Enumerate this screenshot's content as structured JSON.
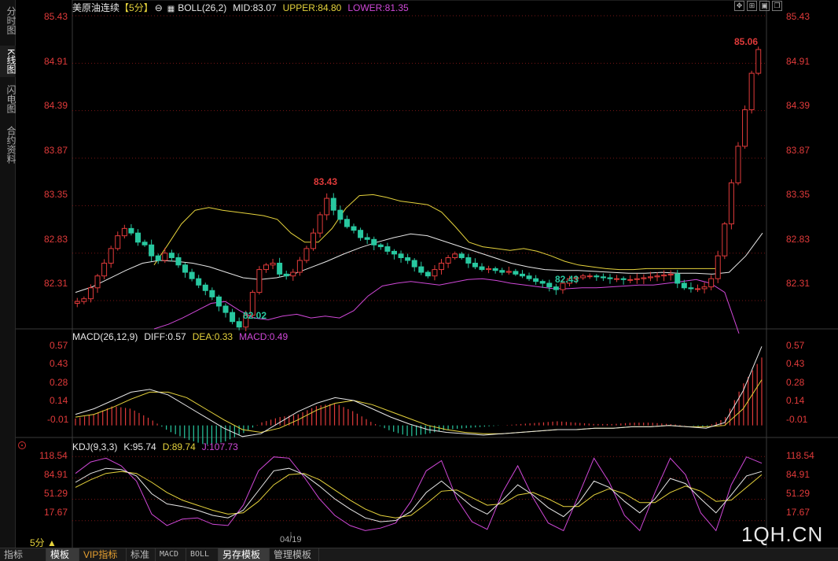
{
  "side_tabs": [
    {
      "label": "分时图",
      "active": false
    },
    {
      "label": "K线图",
      "active": true
    },
    {
      "label": "闪电图",
      "active": false
    },
    {
      "label": "合约资料",
      "active": false
    }
  ],
  "main_header": {
    "instrument": "美原油连续",
    "period_tag": "【5分】",
    "boll_label": "BOLL(26,2)",
    "mid": "MID:83.07",
    "upper": "UPPER:84.80",
    "lower": "LOWER:81.35"
  },
  "macd_header": {
    "label": "MACD(26,12,9)",
    "diff": "DIFF:0.57",
    "dea": "DEA:0.33",
    "macd": "MACD:0.49"
  },
  "kdj_header": {
    "label": "KDJ(9,3,3)",
    "k": "K:95.74",
    "d": "D:89.74",
    "j": "J:107.73"
  },
  "toolbar_icons": [
    "fullscreen-icon",
    "expand-icon",
    "chart-settings-icon",
    "restore-icon",
    "close-icon"
  ],
  "price_axis_ticks": [
    "85.43",
    "84.91",
    "84.39",
    "83.87",
    "83.35",
    "82.83",
    "82.31"
  ],
  "macd_axis_ticks": [
    "0.57",
    "0.43",
    "0.28",
    "0.14",
    "-0.01"
  ],
  "kdj_axis_ticks": [
    "118.54",
    "84.91",
    "51.29",
    "17.67"
  ],
  "annotations": {
    "high": "85.06",
    "local_high": "83.43",
    "low": "82.02",
    "local_low": "82.43"
  },
  "x_axis_label": "04/19",
  "period_selector": "5分 ▲",
  "watermark": "1QH.CN",
  "bottom_tabs": [
    {
      "label": "指标",
      "active": false,
      "vip": false,
      "mono": false
    },
    {
      "label": "模板",
      "active": true,
      "vip": false,
      "mono": false
    },
    {
      "label": "VIP指标",
      "active": false,
      "vip": true,
      "mono": false
    },
    {
      "label": "标准",
      "active": false,
      "vip": false,
      "mono": false
    },
    {
      "label": "MACD",
      "active": false,
      "vip": false,
      "mono": true
    },
    {
      "label": "BOLL",
      "active": false,
      "vip": false,
      "mono": true
    },
    {
      "label": "另存模板",
      "active": true,
      "vip": false,
      "mono": false
    },
    {
      "label": "管理模板",
      "active": false,
      "vip": false,
      "mono": false
    }
  ],
  "colors": {
    "up": "#e03a3a",
    "down": "#28c8a0",
    "mid_line": "#e8e8e8",
    "upper_line": "#e6d33c",
    "lower_line": "#d048d8",
    "grid": "#7a1616",
    "border": "#3a3a3a"
  },
  "chart_data": {
    "type": "candlestick",
    "price_axis": {
      "min": 82.0,
      "max": 85.43
    },
    "price_path": [
      82.3,
      82.33,
      82.45,
      82.58,
      82.72,
      82.88,
      83.02,
      83.1,
      83.05,
      82.95,
      82.92,
      82.8,
      82.75,
      82.83,
      82.78,
      82.7,
      82.62,
      82.55,
      82.48,
      82.42,
      82.35,
      82.25,
      82.18,
      82.08,
      82.02,
      82.15,
      82.4,
      82.65,
      82.7,
      82.72,
      82.6,
      82.58,
      82.62,
      82.75,
      82.88,
      83.05,
      83.25,
      83.43,
      83.3,
      83.2,
      83.12,
      83.08,
      83.0,
      82.98,
      82.92,
      82.9,
      82.85,
      82.82,
      82.78,
      82.75,
      82.68,
      82.62,
      82.58,
      82.65,
      82.72,
      82.78,
      82.82,
      82.78,
      82.72,
      82.68,
      82.65,
      82.66,
      82.64,
      82.62,
      82.63,
      82.6,
      82.58,
      82.55,
      82.52,
      82.5,
      82.46,
      82.43,
      82.5,
      82.55,
      82.56,
      82.58,
      82.58,
      82.57,
      82.56,
      82.55,
      82.55,
      82.54,
      82.54,
      82.55,
      82.56,
      82.57,
      82.58,
      82.59,
      82.6,
      82.5,
      82.45,
      82.44,
      82.44,
      82.46,
      82.55,
      82.8,
      83.15,
      83.6,
      84.0,
      84.4,
      84.8,
      85.06
    ],
    "boll_mid_path": [
      82.4,
      82.46,
      82.55,
      82.64,
      82.72,
      82.75,
      82.74,
      82.72,
      82.68,
      82.62,
      82.56,
      82.54,
      82.56,
      82.6,
      82.67,
      82.74,
      82.82,
      82.89,
      82.95,
      83.0,
      83.04,
      83.02,
      82.96,
      82.9,
      82.84,
      82.78,
      82.72,
      82.68,
      82.65,
      82.64,
      82.64,
      82.63,
      82.62,
      82.61,
      82.61,
      82.62,
      82.61,
      82.61,
      82.6,
      82.62,
      82.8,
      83.05
    ],
    "boll_upper_path": [
      82.7,
      82.92,
      83.15,
      83.3,
      83.33,
      83.3,
      83.28,
      83.26,
      83.24,
      83.2,
      83.05,
      82.95,
      82.95,
      83.1,
      83.32,
      83.46,
      83.47,
      83.44,
      83.4,
      83.38,
      83.36,
      83.28,
      83.12,
      82.95,
      82.9,
      82.88,
      82.86,
      82.88,
      82.85,
      82.8,
      82.74,
      82.7,
      82.68,
      82.66,
      82.65,
      82.65,
      82.66,
      82.66,
      82.66,
      82.66,
      82.66,
      82.66
    ],
    "boll_lower_path": [
      82.0,
      82.05,
      82.12,
      82.2,
      82.28,
      82.3,
      82.2,
      82.12,
      82.1,
      82.14,
      82.16,
      82.12,
      82.14,
      82.12,
      82.2,
      82.36,
      82.47,
      82.5,
      82.52,
      82.5,
      82.48,
      82.51,
      82.54,
      82.55,
      82.53,
      82.5,
      82.48,
      82.46,
      82.44,
      82.44,
      82.45,
      82.45,
      82.46,
      82.47,
      82.48,
      82.48,
      82.5,
      82.52,
      82.54,
      82.5,
      82.4,
      81.95
    ],
    "macd": {
      "axis": {
        "min": -0.07,
        "max": 0.6
      },
      "diff_path": [
        0.08,
        0.12,
        0.18,
        0.24,
        0.26,
        0.22,
        0.14,
        0.06,
        -0.02,
        -0.08,
        -0.06,
        0.02,
        0.1,
        0.16,
        0.2,
        0.18,
        0.12,
        0.06,
        0.01,
        -0.03,
        -0.05,
        -0.06,
        -0.07,
        -0.06,
        -0.05,
        -0.04,
        -0.03,
        -0.03,
        -0.02,
        -0.02,
        -0.01,
        -0.01,
        0.0,
        -0.01,
        -0.02,
        0.02,
        0.25,
        0.57
      ],
      "dea_path": [
        0.06,
        0.08,
        0.13,
        0.19,
        0.24,
        0.24,
        0.2,
        0.12,
        0.04,
        -0.03,
        -0.05,
        -0.02,
        0.04,
        0.11,
        0.16,
        0.18,
        0.15,
        0.1,
        0.05,
        0.0,
        -0.03,
        -0.05,
        -0.06,
        -0.06,
        -0.05,
        -0.04,
        -0.03,
        -0.03,
        -0.02,
        -0.02,
        -0.01,
        -0.01,
        0.0,
        -0.01,
        -0.01,
        0.0,
        0.12,
        0.33
      ],
      "hist_path": [
        0.05,
        0.08,
        0.14,
        0.12,
        0.05,
        -0.04,
        -0.1,
        -0.14,
        -0.12,
        -0.06,
        0.02,
        0.06,
        0.08,
        0.14,
        0.16,
        0.1,
        0.02,
        -0.04,
        -0.08,
        -0.06,
        -0.03,
        -0.02,
        -0.01,
        0.0,
        0.01,
        0.02,
        0.03,
        0.02,
        0.01,
        0.01,
        0.02,
        0.02,
        0.01,
        0.0,
        -0.01,
        0.05,
        0.3,
        0.49
      ]
    },
    "kdj": {
      "axis": {
        "min": 0,
        "max": 125
      },
      "k_path": [
        78,
        92,
        100,
        98,
        88,
        60,
        44,
        40,
        34,
        26,
        22,
        34,
        65,
        96,
        100,
        90,
        72,
        52,
        36,
        22,
        16,
        18,
        32,
        62,
        80,
        60,
        40,
        28,
        50,
        74,
        58,
        38,
        24,
        46,
        80,
        70,
        48,
        30,
        52,
        84,
        76,
        52,
        30,
        58,
        88,
        95
      ],
      "d_path": [
        70,
        82,
        92,
        95,
        92,
        78,
        62,
        50,
        42,
        34,
        28,
        30,
        48,
        74,
        90,
        92,
        82,
        66,
        50,
        36,
        26,
        22,
        26,
        44,
        64,
        66,
        54,
        42,
        44,
        58,
        62,
        52,
        40,
        40,
        58,
        68,
        60,
        46,
        46,
        62,
        72,
        64,
        48,
        50,
        70,
        90
      ],
      "j_path": [
        92,
        110,
        116,
        104,
        80,
        28,
        10,
        20,
        22,
        12,
        10,
        42,
        96,
        118,
        116,
        86,
        52,
        26,
        10,
        2,
        6,
        14,
        48,
        96,
        112,
        52,
        16,
        4,
        62,
        104,
        54,
        14,
        2,
        58,
        116,
        78,
        26,
        2,
        62,
        116,
        90,
        30,
        2,
        74,
        118,
        108
      ]
    }
  }
}
